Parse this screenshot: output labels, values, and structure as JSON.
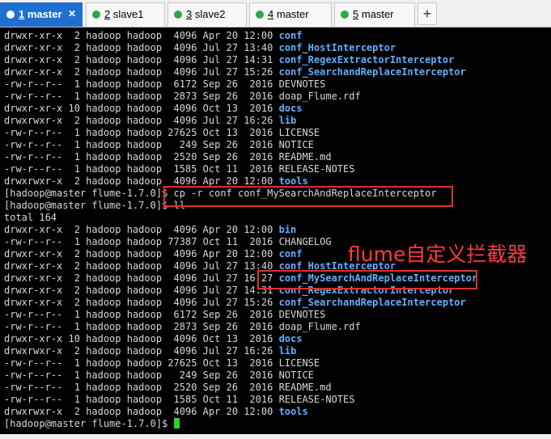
{
  "tabs": [
    {
      "num": "1",
      "label": "master",
      "active": true,
      "dot": "red"
    },
    {
      "num": "2",
      "label": "slave1",
      "active": false,
      "dot": "green"
    },
    {
      "num": "3",
      "label": "slave2",
      "active": false,
      "dot": "green"
    },
    {
      "num": "4",
      "label": "master",
      "active": false,
      "dot": "green"
    },
    {
      "num": "5",
      "label": "master",
      "active": false,
      "dot": "green"
    }
  ],
  "close_glyph": "✕",
  "add_glyph": "+",
  "annotation": "flume自定义拦截器",
  "colors": {
    "accent": "#1e6fd0",
    "directory": "#5fb0ff",
    "text": "#d8d8d8",
    "highlight": "#e03030",
    "cursor": "#2ed12e"
  },
  "lines": [
    {
      "prefix": "drwxr-xr-x  2 hadoop hadoop  4096 Apr 20 12:00 ",
      "name": "conf",
      "dir": true
    },
    {
      "prefix": "drwxr-xr-x  2 hadoop hadoop  4096 Jul 27 13:40 ",
      "name": "conf_HostInterceptor",
      "dir": true
    },
    {
      "prefix": "drwxr-xr-x  2 hadoop hadoop  4096 Jul 27 14:31 ",
      "name": "conf_RegexExtractorInterceptor",
      "dir": true
    },
    {
      "prefix": "drwxr-xr-x  2 hadoop hadoop  4096 Jul 27 15:26 ",
      "name": "conf_SearchandReplaceInterceptor",
      "dir": true
    },
    {
      "prefix": "-rw-r--r--  1 hadoop hadoop  6172 Sep 26  2016 ",
      "name": "DEVNOTES",
      "dir": false
    },
    {
      "prefix": "-rw-r--r--  1 hadoop hadoop  2873 Sep 26  2016 ",
      "name": "doap_Flume.rdf",
      "dir": false
    },
    {
      "prefix": "drwxr-xr-x 10 hadoop hadoop  4096 Oct 13  2016 ",
      "name": "docs",
      "dir": true
    },
    {
      "prefix": "drwxrwxr-x  2 hadoop hadoop  4096 Jul 27 16:26 ",
      "name": "lib",
      "dir": true
    },
    {
      "prefix": "-rw-r--r--  1 hadoop hadoop 27625 Oct 13  2016 ",
      "name": "LICENSE",
      "dir": false
    },
    {
      "prefix": "-rw-r--r--  1 hadoop hadoop   249 Sep 26  2016 ",
      "name": "NOTICE",
      "dir": false
    },
    {
      "prefix": "-rw-r--r--  1 hadoop hadoop  2520 Sep 26  2016 ",
      "name": "README.md",
      "dir": false
    },
    {
      "prefix": "-rw-r--r--  1 hadoop hadoop  1585 Oct 11  2016 ",
      "name": "RELEASE-NOTES",
      "dir": false
    },
    {
      "prefix": "drwxrwxr-x  2 hadoop hadoop  4096 Apr 20 12:00 ",
      "name": "tools",
      "dir": true
    },
    {
      "prefix": "[hadoop@master flume-1.7.0]$ ",
      "name": "cp -r conf conf_MySearchAndReplaceInterceptor",
      "dir": false
    },
    {
      "prefix": "[hadoop@master flume-1.7.0]$ ",
      "name": "ll",
      "dir": false
    },
    {
      "prefix": "total 164",
      "name": "",
      "dir": false
    },
    {
      "prefix": "drwxr-xr-x  2 hadoop hadoop  4096 Apr 20 12:00 ",
      "name": "bin",
      "dir": true
    },
    {
      "prefix": "-rw-r--r--  1 hadoop hadoop 77387 Oct 11  2016 ",
      "name": "CHANGELOG",
      "dir": false
    },
    {
      "prefix": "drwxr-xr-x  2 hadoop hadoop  4096 Apr 20 12:00 ",
      "name": "conf",
      "dir": true
    },
    {
      "prefix": "drwxr-xr-x  2 hadoop hadoop  4096 Jul 27 13:40 ",
      "name": "conf_HostInterceptor",
      "dir": true
    },
    {
      "prefix": "drwxr-xr-x  2 hadoop hadoop  4096 Jul 27 16:27 ",
      "name": "conf_MySearchAndReplaceInterceptor",
      "dir": true
    },
    {
      "prefix": "drwxr-xr-x  2 hadoop hadoop  4096 Jul 27 14:31 ",
      "name": "conf_RegexExtractorInterceptor",
      "dir": true
    },
    {
      "prefix": "drwxr-xr-x  2 hadoop hadoop  4096 Jul 27 15:26 ",
      "name": "conf_SearchandReplaceInterceptor",
      "dir": true
    },
    {
      "prefix": "-rw-r--r--  1 hadoop hadoop  6172 Sep 26  2016 ",
      "name": "DEVNOTES",
      "dir": false
    },
    {
      "prefix": "-rw-r--r--  1 hadoop hadoop  2873 Sep 26  2016 ",
      "name": "doap_Flume.rdf",
      "dir": false
    },
    {
      "prefix": "drwxr-xr-x 10 hadoop hadoop  4096 Oct 13  2016 ",
      "name": "docs",
      "dir": true
    },
    {
      "prefix": "drwxrwxr-x  2 hadoop hadoop  4096 Jul 27 16:26 ",
      "name": "lib",
      "dir": true
    },
    {
      "prefix": "-rw-r--r--  1 hadoop hadoop 27625 Oct 13  2016 ",
      "name": "LICENSE",
      "dir": false
    },
    {
      "prefix": "-rw-r--r--  1 hadoop hadoop   249 Sep 26  2016 ",
      "name": "NOTICE",
      "dir": false
    },
    {
      "prefix": "-rw-r--r--  1 hadoop hadoop  2520 Sep 26  2016 ",
      "name": "README.md",
      "dir": false
    },
    {
      "prefix": "-rw-r--r--  1 hadoop hadoop  1585 Oct 11  2016 ",
      "name": "RELEASE-NOTES",
      "dir": false
    },
    {
      "prefix": "drwxrwxr-x  2 hadoop hadoop  4096 Apr 20 12:00 ",
      "name": "tools",
      "dir": true
    },
    {
      "prefix": "[hadoop@master flume-1.7.0]$ ",
      "name": "",
      "dir": false,
      "cursor": true
    }
  ]
}
